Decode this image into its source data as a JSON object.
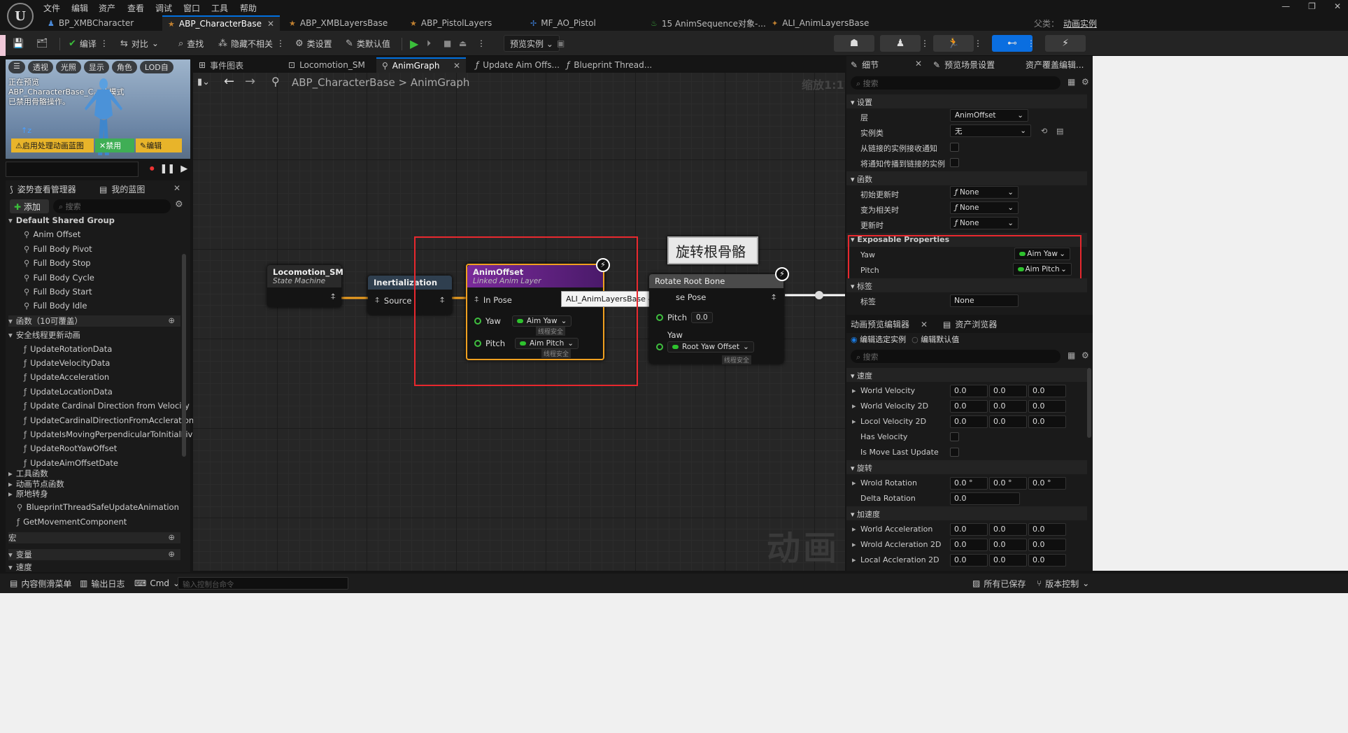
{
  "menu": [
    "文件",
    "编辑",
    "资产",
    "查看",
    "调试",
    "窗口",
    "工具",
    "帮助"
  ],
  "tabs": [
    "BP_XMBCharacter",
    "ABP_CharacterBase",
    "ABP_XMBLayersBase",
    "ABP_PistolLayers",
    "MF_AO_Pistol",
    "15 AnimSequence对象-...",
    "ALI_AnimLayersBase"
  ],
  "parent_label": "父类：",
  "parent_value": "动画实例",
  "toolbar": {
    "compile": "编译",
    "diff": "对比",
    "find": "查找",
    "hide": "隐藏不相关",
    "class_settings": "类设置",
    "class_defaults": "类默认值",
    "preview": "预览实例"
  },
  "viewport": {
    "pills": [
      "透视",
      "光照",
      "显示",
      "角色",
      "LOD自"
    ],
    "warning": "正在预览ABP_CharacterBase_C。此模式已禁用骨骼操作。",
    "btn_warn": "启用处理动画蓝图",
    "btn_disable": "禁用",
    "btn_edit": "编辑"
  },
  "left": {
    "pose_manager": "姿势查看管理器",
    "my_blueprint": "我的蓝图",
    "add": "添加",
    "search": "搜索",
    "group": "Default Shared Group",
    "group_items": [
      "Anim Offset",
      "Full Body Pivot",
      "Full Body Stop",
      "Full Body Cycle",
      "Full Body Start",
      "Full Body Idle"
    ],
    "functions_header": "函数（10可覆盖）",
    "thread_safe": "安全线程更新动画",
    "functions": [
      "UpdateRotationData",
      "UpdateVelocityData",
      "UpdateAcceleration",
      "UpdateLocationData",
      "Update Cardinal Direction from Velocity",
      "UpdateCardinalDirectionFromAccleration",
      "UpdateIsMovingPerpendicularToInitialPivot",
      "UpdateRootYawOffset",
      "UpdateAimOffsetDate"
    ],
    "tool_functions": "工具函数",
    "anim_node_functions": "动画节点函数",
    "turn_in_place": "原地转身",
    "extra": [
      "BlueprintThreadSafeUpdateAnimation",
      "GetMovementComponent"
    ],
    "macros": "宏",
    "variables": "变量",
    "speed": "速度"
  },
  "graph_tabs": [
    "事件图表",
    "Locomotion_SM",
    "AnimGraph",
    "Update Aim Offs...",
    "Blueprint Thread..."
  ],
  "breadcrumb": {
    "root": "ABP_CharacterBase",
    "sep": ">",
    "leaf": "AnimGraph"
  },
  "zoom": "缩放1:1",
  "watermark": "动画",
  "nodes": {
    "loco": {
      "title": "Locomotion_SM",
      "sub": "State Machine"
    },
    "inert": {
      "title": "Inertialization",
      "pin": "Source"
    },
    "aim": {
      "title": "AnimOffset",
      "sub": "Linked Anim Layer",
      "in_pose": "In Pose",
      "yaw": "Yaw",
      "yaw_val": "Aim Yaw",
      "pitch": "Pitch",
      "pitch_val": "Aim Pitch",
      "thread": "线程安全"
    },
    "root": {
      "title": "Rotate Root Bone",
      "pose": "se Pose",
      "pitch": "Pitch",
      "pitch_val": "0.0",
      "yaw": "Yaw",
      "yaw_val": "Root Yaw Offset",
      "thread": "线程安全"
    },
    "comment": "旋转根骨骼",
    "tooltip": "ALI_AnimLayersBase - AnimOffset"
  },
  "details": {
    "tab": "细节",
    "preview_settings": "预览场景设置",
    "asset_override": "资产覆盖编辑...",
    "search": "搜索",
    "settings": "设置",
    "layer": "层",
    "layer_val": "AnimOffset",
    "instance": "实例类",
    "instance_val": "无",
    "recv": "从链接的实例接收通知",
    "prop": "将通知传播到链接的实例",
    "func": "函数",
    "f1": "初始更新时",
    "f2": "变为相关时",
    "f3": "更新时",
    "none": "None",
    "expose": "Exposable Properties",
    "yaw": "Yaw",
    "yaw_val": "Aim Yaw",
    "pitch": "Pitch",
    "pitch_val": "Aim Pitch",
    "tags": "标签",
    "tag": "标签",
    "tag_val": "None"
  },
  "preview": {
    "tab": "动画预览编辑器",
    "asset_browser": "资产浏览器",
    "edit_instance": "编辑选定实例",
    "edit_default": "编辑默认值",
    "search": "搜索",
    "speed": "速度",
    "rows1": [
      {
        "l": "World Velocity",
        "v": [
          "0.0",
          "0.0",
          "0.0"
        ]
      },
      {
        "l": "World Velocity 2D",
        "v": [
          "0.0",
          "0.0",
          "0.0"
        ]
      },
      {
        "l": "Locol Velocity 2D",
        "v": [
          "0.0",
          "0.0",
          "0.0"
        ]
      }
    ],
    "has_vel": "Has Velocity",
    "moved": "Is Move Last Update",
    "rot": "旋转",
    "rot_row": {
      "l": "Wrold Rotation",
      "v": [
        "0.0 °",
        "0.0 °",
        "0.0 °"
      ]
    },
    "delta": {
      "l": "Delta Rotation",
      "v": "0.0"
    },
    "acc": "加速度",
    "rows2": [
      {
        "l": "World Acceleration",
        "v": [
          "0.0",
          "0.0",
          "0.0"
        ]
      },
      {
        "l": "Wrold Accleration 2D",
        "v": [
          "0.0",
          "0.0",
          "0.0"
        ]
      },
      {
        "l": "Local Accleration 2D",
        "v": [
          "0.0",
          "0.0",
          "0.0"
        ]
      }
    ]
  },
  "status": {
    "drawer": "内容侧滑菜单",
    "log": "输出日志",
    "cmd": "Cmd",
    "cmd_ph": "输入控制台命令",
    "saved": "所有已保存",
    "vc": "版本控制"
  }
}
